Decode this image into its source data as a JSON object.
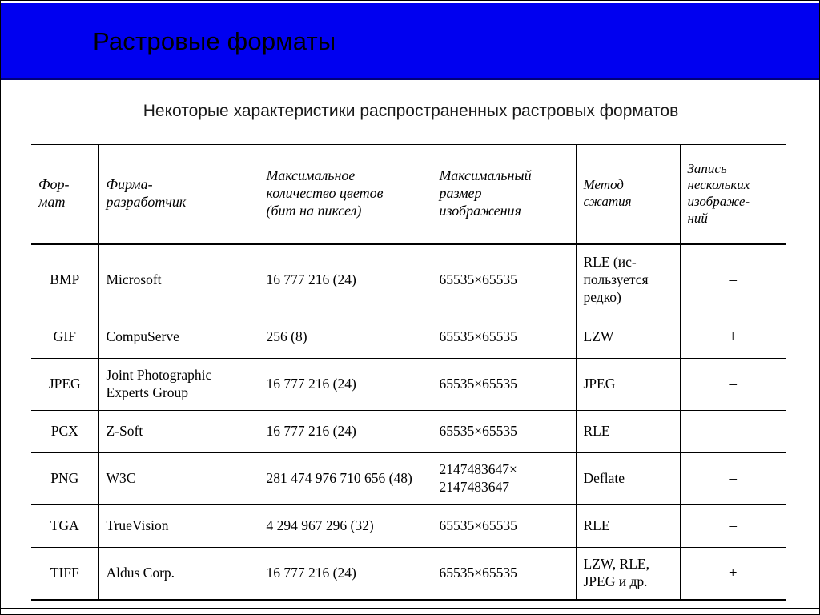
{
  "slide": {
    "title": "Растровые форматы",
    "subtitle": "Некоторые характеристики распространенных растровых форматов",
    "banner_color": "#0000F0",
    "text_color": "#000000"
  },
  "table": {
    "headers": [
      "Фор-\nмат",
      "Фирма-\nразработчик",
      "Максимальное\nколичество цветов\n(бит на пиксел)",
      "Максимальный\nразмер\nизображения",
      "Метод\nсжатия",
      "Запись\nнескольких\nизображе-\nний"
    ],
    "headers_flat": [
      "Фор- мат",
      "Фирма- разработчик",
      "Максимальное количество цветов (бит на пиксел)",
      "Максимальный размер изображения",
      "Метод сжатия",
      "Запись нескольких изображе- ний"
    ],
    "rows": [
      {
        "format": "BMP",
        "vendor": "Microsoft",
        "max_colors": "16 777 216 (24)",
        "max_size": "65535×65535",
        "compression": "RLE (ис-пользуется редко)",
        "multi_image": "–"
      },
      {
        "format": "GIF",
        "vendor": "CompuServe",
        "max_colors": "256 (8)",
        "max_size": "65535×65535",
        "compression": "LZW",
        "multi_image": "+"
      },
      {
        "format": "JPEG",
        "vendor": "Joint Photographic Experts Group",
        "max_colors": "16 777 216 (24)",
        "max_size": "65535×65535",
        "compression": "JPEG",
        "multi_image": "–"
      },
      {
        "format": "PCX",
        "vendor": "Z-Soft",
        "max_colors": "16 777 216 (24)",
        "max_size": "65535×65535",
        "compression": "RLE",
        "multi_image": "–"
      },
      {
        "format": "PNG",
        "vendor": "W3C",
        "max_colors": "281 474 976 710 656 (48)",
        "max_size": "2147483647× 2147483647",
        "compression": "Deflate",
        "multi_image": "–"
      },
      {
        "format": "TGA",
        "vendor": "TrueVision",
        "max_colors": "4 294 967 296 (32)",
        "max_size": "65535×65535",
        "compression": "RLE",
        "multi_image": "–"
      },
      {
        "format": "TIFF",
        "vendor": "Aldus Corp.",
        "max_colors": "16 777 216 (24)",
        "max_size": "65535×65535",
        "compression": "LZW, RLE, JPEG и др.",
        "multi_image": "+"
      }
    ]
  }
}
